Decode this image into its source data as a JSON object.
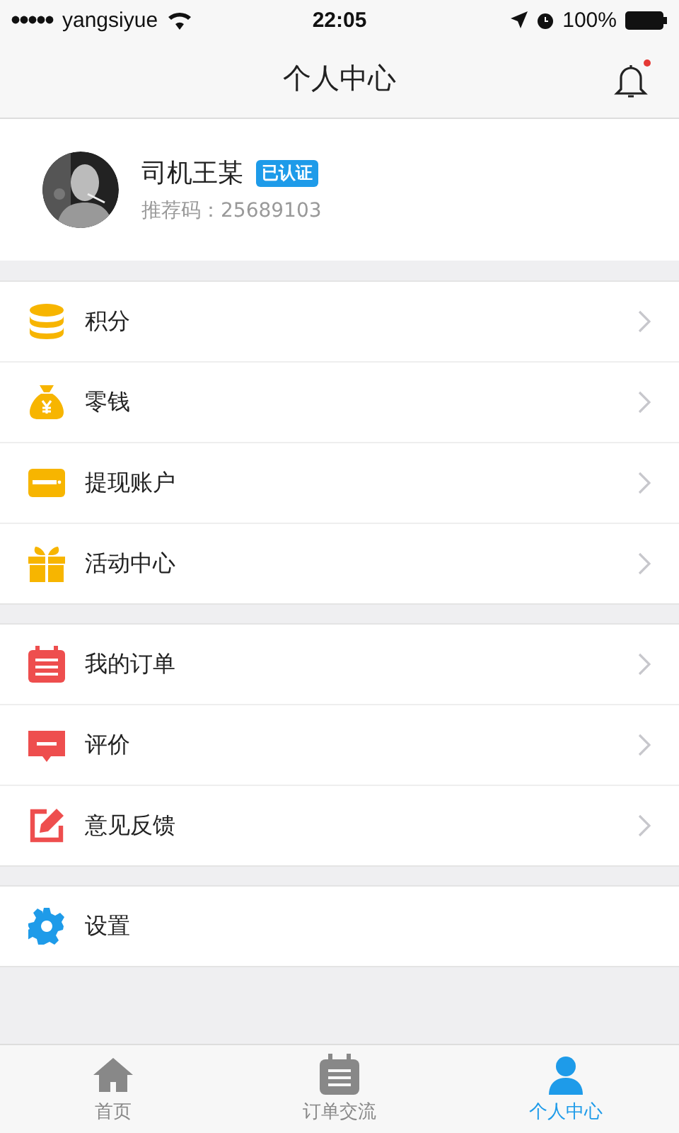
{
  "status_bar": {
    "carrier": "yangsiyue",
    "time": "22:05",
    "battery": "100%"
  },
  "nav_bar": {
    "title": "个人中心",
    "notification_unread": true
  },
  "profile": {
    "name": "司机王某",
    "badge": "已认证",
    "referral": "推荐码：25689103"
  },
  "menu_groups": [
    {
      "items": [
        {
          "label": "积分"
        },
        {
          "label": "零钱"
        },
        {
          "label": "提现账户"
        },
        {
          "label": "活动中心"
        }
      ]
    },
    {
      "items": [
        {
          "label": "我的订单"
        },
        {
          "label": "评价"
        },
        {
          "label": "意见反馈"
        }
      ]
    },
    {
      "items": [
        {
          "label": "设置"
        }
      ]
    }
  ],
  "tab_bar": [
    {
      "label": "首页",
      "selected": false
    },
    {
      "label": "订单交流",
      "selected": false
    },
    {
      "label": "个人中心",
      "selected": true
    }
  ]
}
